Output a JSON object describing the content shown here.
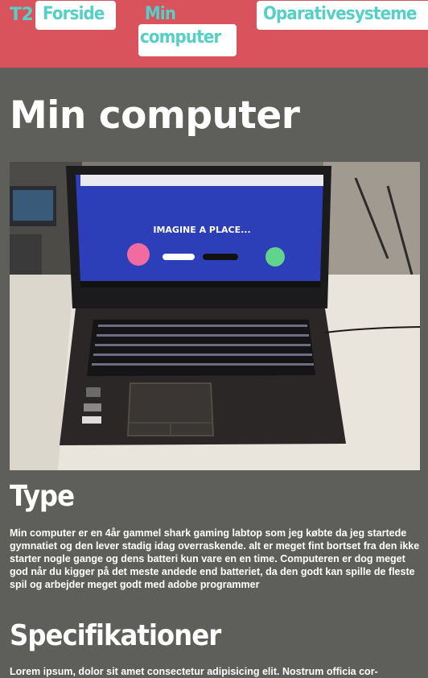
{
  "nav": {
    "logo": "T2",
    "links": [
      {
        "label": "Forside"
      },
      {
        "label_line1": "Min",
        "label_line2": "computer"
      },
      {
        "label": "Oparativesysteme"
      }
    ]
  },
  "page": {
    "title": "Min computer"
  },
  "photo": {
    "screen_banner": "IMAGINE A PLACE..."
  },
  "sections": [
    {
      "heading": "Type",
      "body": "Min computer er en 4år gammel shark gaming labtop som jeg købte da jeg startede gymnatiet og den lever stadig idag overraskende. alt er meget fint bortset fra den ikke starter nogle gange og dens batteri kun vare en en time. Computeren er dog meget god når du kigger på det meste andede end batteriet, da den godt kan spille de fleste spil og arbejder meget godt med adobe programmer"
    },
    {
      "heading": "Specifikationer",
      "body": "Lorem ipsum, dolor sit amet consectetur adipisicing elit. Nostrum officia cor-"
    }
  ],
  "colors": {
    "nav_bg": "#d9535c",
    "accent": "#55d0c6",
    "page_bg": "#5e5f5a"
  }
}
